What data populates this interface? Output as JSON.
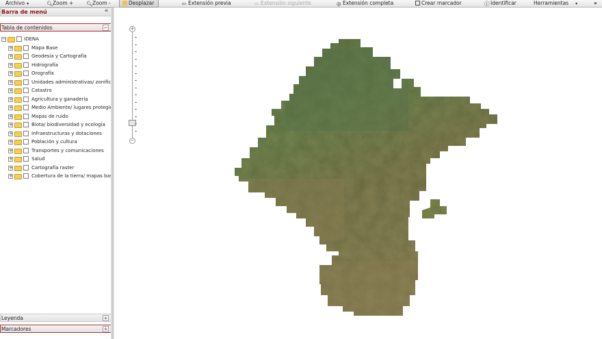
{
  "toolbar": {
    "archivo": "Archivo",
    "zoom_in": "Zoom +",
    "zoom_out": "Zoom -",
    "desplazar": "Desplazar",
    "extension_previa": "Extensión previa",
    "extension_siguiente": "Extensión siguiente",
    "extension_completa": "Extensión completa",
    "crear_marcador": "Crear marcador",
    "identificar": "Identificar",
    "herramientas": "Herramientas",
    "more": "»"
  },
  "panel": {
    "menu_title": "Barra de menú",
    "collapse_glyph": "«",
    "toc_title": "Tabla de contenidos",
    "toc_glyph": "−",
    "root": "IDENA",
    "layers": [
      "Mapa Base",
      "Geodesia y Cartografía",
      "Hidrografía",
      "Orografía",
      "Unidades administrativas/ zonificación",
      "Catastro",
      "Agricultura y ganadería",
      "Medio Ambiente/ lugares protegidos",
      "Mapas de ruido",
      "Biota/ biodiversidad y ecología",
      "Infraestructuras y dotaciones",
      "Población y cultura",
      "Transportes y comunicaciones",
      "Salud",
      "Cartografía raster",
      "Cobertura de la tierra/ mapas base"
    ],
    "leyenda": "Leyenda",
    "marcadores": "Marcadores",
    "plus_glyph": "+"
  },
  "map": {
    "zoom_plus": "+",
    "zoom_minus": "−",
    "colors": {
      "terrain_dark": "#5e6a3a",
      "terrain_mid": "#7f8a4f",
      "terrain_light": "#98a268",
      "terrain_brown": "#8a7d53"
    }
  }
}
